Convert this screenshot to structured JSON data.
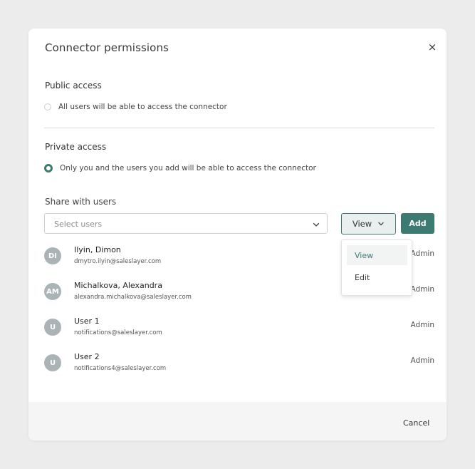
{
  "dialog": {
    "title": "Connector permissions",
    "close_icon": "close-icon",
    "close_symbol": "×"
  },
  "public_access": {
    "label": "Public access",
    "option_text": "All users will be able to access the connector",
    "selected": false
  },
  "private_access": {
    "label": "Private access",
    "option_text": "Only you and the users you add will be able to access the connector",
    "selected": true
  },
  "share": {
    "label": "Share with users",
    "select_placeholder": "Select users",
    "permission_value": "View",
    "add_label": "Add",
    "permission_options": [
      "View",
      "Edit"
    ]
  },
  "users": [
    {
      "initials": "DI",
      "name": "Ilyin, Dimon",
      "email": "dmytro.ilyin@saleslayer.com",
      "role": "Admin"
    },
    {
      "initials": "AM",
      "name": "Michalkova, Alexandra",
      "email": "alexandra.michalkova@saleslayer.com",
      "role": "Admin"
    },
    {
      "initials": "U",
      "name": "User 1",
      "email": "notifications@saleslayer.com",
      "role": "Admin"
    },
    {
      "initials": "U",
      "name": "User 2",
      "email": "notifications4@saleslayer.com",
      "role": "Admin"
    }
  ],
  "footer": {
    "cancel_label": "Cancel"
  },
  "colors": {
    "accent": "#3d7a72",
    "avatar": "#aab4b7",
    "background": "#ececec",
    "footer": "#f5f5f5"
  }
}
